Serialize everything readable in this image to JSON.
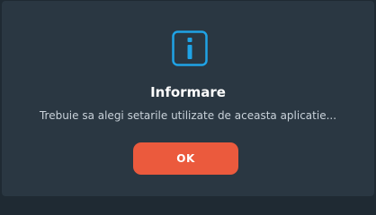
{
  "dialog": {
    "icon": "info-icon",
    "title": "Informare",
    "message": "Trebuie sa alegi setarile utilizate de aceasta aplicatie...",
    "ok_label": "OK"
  },
  "colors": {
    "background": "#1f2a33",
    "dialog_background": "#2a3742",
    "accent_icon": "#1fa3e6",
    "button": "#eb5a3d",
    "title_text": "#ffffff",
    "message_text": "#c9d2da"
  }
}
